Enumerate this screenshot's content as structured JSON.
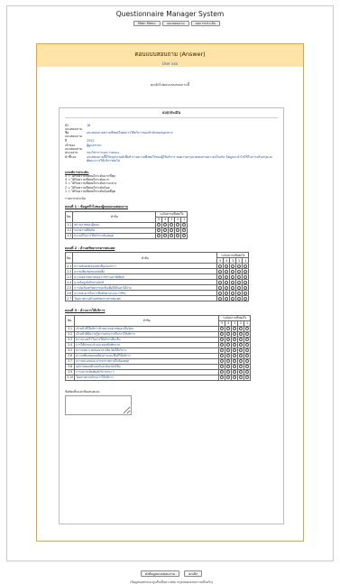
{
  "app": {
    "title": "Questionnaire Manager System"
  },
  "nav": {
    "items": [
      {
        "label": "Main Menu"
      },
      {
        "label": "แบบสอบถาม"
      },
      {
        "label": "ผลการประเมิน"
      }
    ]
  },
  "header": {
    "title": "ตอบแบบสอบถาม (Answer)",
    "user": "User xxx"
  },
  "message": "คุณยังไม่ตอบแบบสอบถามนี้",
  "form": {
    "title": "แบบประเมิน",
    "meta": [
      {
        "key": "ID แบบสอบถาม",
        "value": "18"
      },
      {
        "key": "ชื่อแบบสอบถาม",
        "value": "แบบสอบถามความพึงพอใจต่อการให้บริการของสำนักหอสมุดกลาง"
      },
      {
        "key": "ปี",
        "value": "2552"
      },
      {
        "key": "เจ้าของแบบสอบถาม",
        "value": "ผู้ดูแลระบบ"
      },
      {
        "key": "หน่วยงาน",
        "value": "กองวิชาการและวางแผน"
      },
      {
        "key": "คำชี้แจง",
        "value": "แบบสอบถามนี้มีวัตถุประสงค์เพื่อสำรวจความพึงพอใจของผู้ใช้บริการ ขอความกรุณาตอบตามความเป็นจริง ข้อมูลจะนำไปใช้ในการปรับปรุงและพัฒนาการให้บริการต่อไป"
      }
    ],
    "criteria": {
      "title": "เกณฑ์การประเมิน",
      "levels": [
        "5 = ได้รับความพึงพอใจระดับมากที่สุด",
        "4 = ได้รับความพึงพอใจระดับมาก",
        "3 = ได้รับความพึงพอใจระดับปานกลาง",
        "2 = ได้รับความพึงพอใจระดับน้อย",
        "1 = ได้รับความพึงพอใจระดับน้อยที่สุด"
      ],
      "footer": "รายการประเมิน"
    },
    "sections": [
      {
        "title": "ตอนที่ 1 : ข้อมูลทั่วไปของผู้ตอบแบบสอบถาม",
        "col_no": "No.",
        "col_item": "หัวข้อ",
        "col_level": "ระดับความพึงพอใจ",
        "scores": [
          "5",
          "4",
          "3",
          "2",
          "1"
        ],
        "rows": [
          {
            "no": "1.1",
            "text": "สถานภาพของผู้ตอบ"
          },
          {
            "no": "1.2",
            "text": "หน่วยงานที่สังกัด"
          },
          {
            "no": "1.3",
            "text": "ความถี่ในการใช้บริการห้องสมุด"
          }
        ]
      },
      {
        "title": "ตอนที่ 2 : ด้านทรัพยากรสารสนเทศ",
        "col_no": "No.",
        "col_item": "หัวข้อ",
        "col_level": "ระดับความพึงพอใจ",
        "scores": [
          "5",
          "4",
          "3",
          "2",
          "1"
        ],
        "rows": [
          {
            "no": "2.1",
            "text": "ความทันสมัยของหนังสือและตำรา"
          },
          {
            "no": "2.2",
            "text": "ความเพียงพอของหนังสือ"
          },
          {
            "no": "2.3",
            "text": "ความหลากหลายของวารสารและสิ่งพิมพ์"
          },
          {
            "no": "2.4",
            "text": "ฐานข้อมูลอิเล็กทรอนิกส์"
          },
          {
            "no": "2.5",
            "text": "การจัดเรียงทรัพยากรบนชั้นเพื่อให้ค้นหาได้ง่าย"
          },
          {
            "no": "2.6",
            "text": "ความสะดวกในการสืบค้นผ่านระบบ OPAC"
          },
          {
            "no": "2.7",
            "text": "โดยภาพรวมด้านทรัพยากรสารสนเทศ"
          }
        ]
      },
      {
        "title": "ตอนที่ 3 : ด้านการให้บริการ",
        "col_no": "No.",
        "col_item": "หัวข้อ",
        "col_level": "ระดับความพึงพอใจ",
        "scores": [
          "5",
          "4",
          "3",
          "2",
          "1"
        ],
        "rows": [
          {
            "no": "3.1",
            "text": "เจ้าหน้าที่ให้บริการด้วยความสุภาพและเป็นมิตร"
          },
          {
            "no": "3.2",
            "text": "เจ้าหน้าที่มีความรู้ความสามารถในการให้บริการ"
          },
          {
            "no": "3.3",
            "text": "ความรวดเร็วในการให้บริการยืม-คืน"
          },
          {
            "no": "3.4",
            "text": "การให้คำแนะนำและตอบข้อซักถาม"
          },
          {
            "no": "3.5",
            "text": "ความเหมาะสมของเวลาเปิด-ปิดให้บริการ"
          },
          {
            "no": "3.6",
            "text": "ความเพียงพอของที่นั่งอ่านและพื้นที่ให้บริการ"
          },
          {
            "no": "3.7",
            "text": "ความสะอาดและบรรยากาศภายในห้องสมุด"
          },
          {
            "no": "3.8",
            "text": "อุปกรณ์คอมพิวเตอร์และอินเทอร์เน็ต"
          },
          {
            "no": "3.9",
            "text": "การประชาสัมพันธ์บริการต่าง ๆ"
          },
          {
            "no": "3.10",
            "text": "โดยภาพรวมด้านการให้บริการ"
          }
        ]
      }
    ],
    "comment_label": "ข้อคิดเห็นและข้อเสนอแนะ",
    "buttons": {
      "submit": "ส่งข้อมูลแบบสอบถาม",
      "cancel": "ยกเลิก"
    },
    "note": "(ข้อมูลของท่านจะถูกเก็บเป็นความลับ กรุณาตอบตามความเป็นจริง)"
  }
}
